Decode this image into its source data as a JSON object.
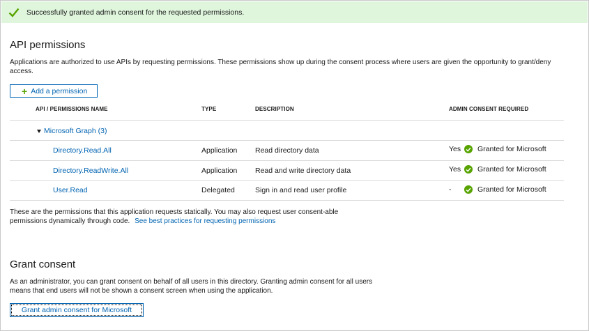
{
  "banner": {
    "message": "Successfully granted admin consent for the requested permissions."
  },
  "api_permissions": {
    "title": "API permissions",
    "description": "Applications are authorized to use APIs by requesting permissions. These permissions show up during the consent process where users are given the opportunity to grant/deny access.",
    "add_button": "Add a permission",
    "columns": [
      "API / PERMISSIONS NAME",
      "TYPE",
      "DESCRIPTION",
      "ADMIN CONSENT REQUIRED"
    ],
    "group": "Microsoft Graph (3)",
    "rows": [
      {
        "name": "Directory.Read.All",
        "type": "Application",
        "description": "Read directory data",
        "admin_required": "Yes",
        "status": "Granted for Microsoft"
      },
      {
        "name": "Directory.ReadWrite.All",
        "type": "Application",
        "description": "Read and write directory data",
        "admin_required": "Yes",
        "status": "Granted for Microsoft"
      },
      {
        "name": "User.Read",
        "type": "Delegated",
        "description": "Sign in and read user profile",
        "admin_required": "-",
        "status": "Granted for Microsoft"
      }
    ],
    "footer_text": "These are the permissions that this application requests statically. You may also request user consent-able permissions dynamically through code.",
    "footer_link": "See best practices for requesting permissions"
  },
  "grant_consent": {
    "title": "Grant consent",
    "description": "As an administrator, you can grant consent on behalf of all users in this directory. Granting admin consent for all users means that end users will not be shown a consent screen when using the application.",
    "button": "Grant admin consent for Microsoft"
  },
  "colors": {
    "accent": "#0063b1",
    "success": "#57a300",
    "banner_bg": "#dff6dd"
  },
  "icons": {
    "banner": "checkmark-icon",
    "add": "plus-icon",
    "group": "caret-down-icon",
    "status": "check-circle-icon"
  }
}
